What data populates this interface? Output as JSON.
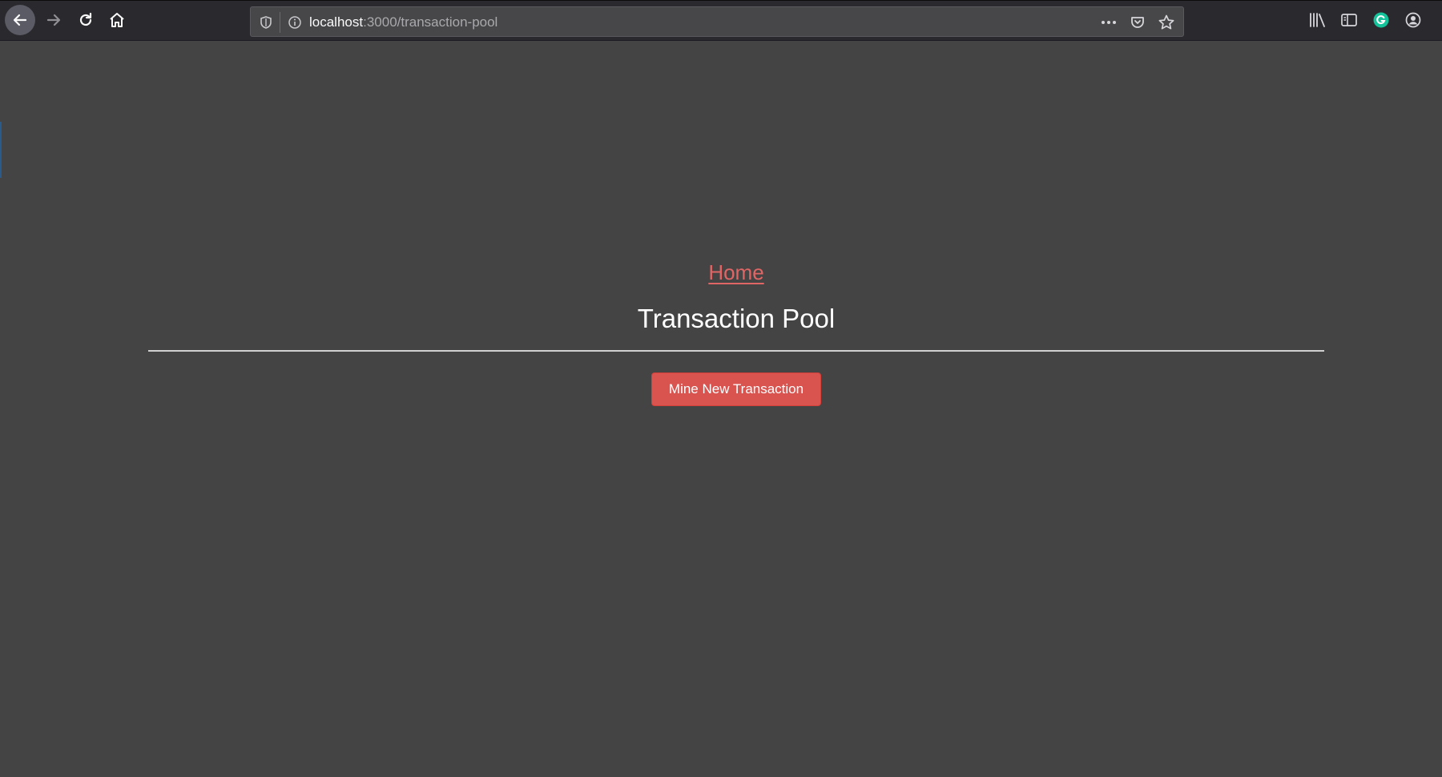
{
  "browser": {
    "url_host": "localhost",
    "url_path": ":3000/transaction-pool",
    "icons": {
      "back": "back-arrow-icon",
      "forward": "forward-arrow-icon",
      "reload": "reload-icon",
      "home": "home-icon",
      "shield": "tracking-shield-icon",
      "info": "site-info-icon",
      "more": "more-actions-icon",
      "pocket": "pocket-icon",
      "bookmark": "bookmark-star-icon",
      "library": "library-icon",
      "sidebar": "sidebar-icon",
      "grammarly": "grammarly-icon",
      "account": "account-icon"
    }
  },
  "page": {
    "home_link": "Home",
    "title": "Transaction Pool",
    "mine_button": "Mine New Transaction"
  },
  "colors": {
    "background": "#444444",
    "link": "#e06666",
    "button": "#d9534f",
    "grammarly": "#15c39a"
  }
}
